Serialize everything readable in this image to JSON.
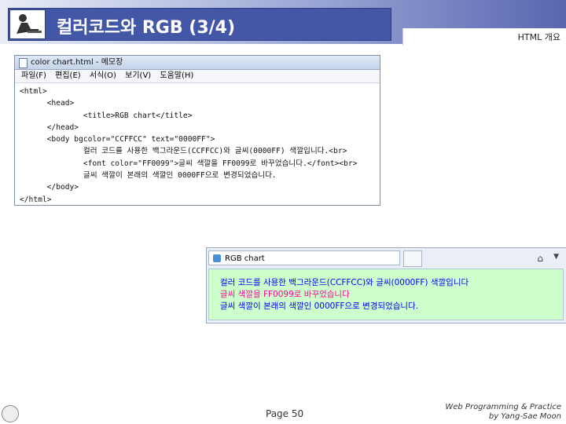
{
  "header": {
    "title": "컬러코드와 RGB (3/4)",
    "section": "HTML 개요"
  },
  "notepad": {
    "window_title": "color chart.html - 메모장",
    "menu": [
      "파일(F)",
      "편집(E)",
      "서식(O)",
      "보기(V)",
      "도움말(H)"
    ],
    "code_lines": [
      "<html>",
      "      <head>",
      "              <title>RGB chart</title>",
      "      </head>",
      "      <body bgcolor=\"CCFFCC\" text=\"0000FF\">",
      "              컬러 코드를 사용한 백그라운드(CCFFCC)와 글씨(0000FF) 색깔입니다.<br>",
      "              <font color=\"FF0099\">글씨 색깔을 FF0099로 바꾸었습니다.</font><br>",
      "              글씨 색깔이 본래의 색깔인 0000FF으로 변경되었습니다.",
      "      </body>",
      "</html>"
    ]
  },
  "browser": {
    "tab_title": "RGB chart",
    "lines": [
      "컬러 코드를 사용한 백그라운드(CCFFCC)와 글씨(0000FF) 색깔입니다",
      "글씨 색깔을 FF0099로 바꾸었습니다",
      "글씨 색깔이 본래의 색깔인 0000FF으로 변경되었습니다."
    ],
    "background_color": "#ccffcc",
    "text_color": "#0000ff",
    "highlight_color": "#ff0099"
  },
  "footer": {
    "page": "Page 50",
    "credit_line1": "Web Programming & Practice",
    "credit_line2": "by Yang-Sae Moon"
  }
}
